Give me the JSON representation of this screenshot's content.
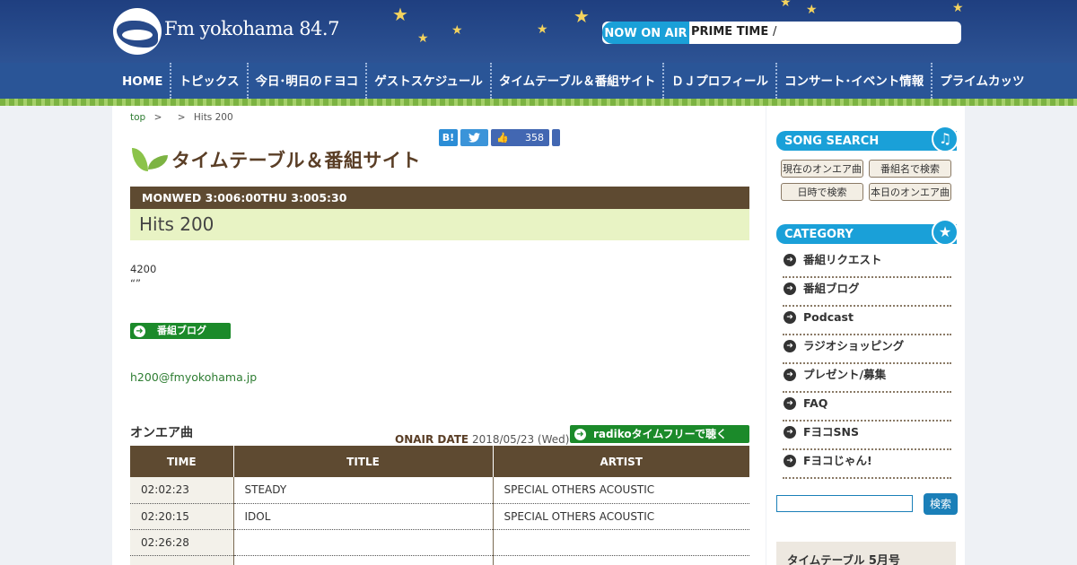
{
  "header": {
    "logo_text": "Fm yokohama 84.7",
    "onair_label": "NOW ON AIR",
    "onair_program": "PRIME TIME",
    "onair_sep": "/",
    "accent": "#1aa0d8",
    "bg": "#284a8a"
  },
  "nav": {
    "items": [
      "HOME",
      "トピックス",
      "今日･明日のＦヨコ",
      "ゲストスケジュール",
      "タイムテーブル＆番組サイト",
      "ＤＪプロフィール",
      "コンサート･イベント情報",
      "プライムカッツ"
    ]
  },
  "breadcrumb": {
    "top": "top",
    "sep1": ">",
    "sep2": ">",
    "current": "Hits 200"
  },
  "social": {
    "hatena": "B!",
    "twitter_icon": "twitter-icon",
    "like_count": "358"
  },
  "section": {
    "title": "タイムテーブル＆番組サイト"
  },
  "program": {
    "time": "MONWED 3:006:00THU 3:005:30",
    "name": "Hits 200",
    "desc_line1": "4200",
    "desc_line2": "“”",
    "blog_button": "番組ブログ",
    "email": "h200@fmyokohama.jp"
  },
  "onair": {
    "title": "オンエア曲",
    "date_label": "ONAIR DATE",
    "date_value": "2018/05/23 (Wed)",
    "radiko_button": "radikoタイムフリーで聴く",
    "headers": [
      "TIME",
      "TITLE",
      "ARTIST"
    ],
    "rows": [
      [
        "02:02:23",
        "STEADY",
        "SPECIAL OTHERS ACOUSTIC"
      ],
      [
        "02:20:15",
        "IDOL",
        "SPECIAL OTHERS ACOUSTIC"
      ],
      [
        "02:26:28",
        "",
        ""
      ],
      [
        "",
        "",
        ""
      ]
    ]
  },
  "sidebar": {
    "song_search": "SONG SEARCH",
    "search_buttons": [
      "現在のオンエア曲",
      "番組名で検索",
      "日時で検索",
      "本日のオンエア曲"
    ],
    "category": "CATEGORY",
    "categories": [
      "番組リクエスト",
      "番組ブログ",
      "Podcast",
      "ラジオショッピング",
      "プレゼント/募集",
      "FAQ",
      "FヨコSNS",
      "Fヨコじゃん!"
    ],
    "search_button": "検索",
    "timetable_label": "タイムテーブル",
    "timetable_month": "5月号"
  }
}
